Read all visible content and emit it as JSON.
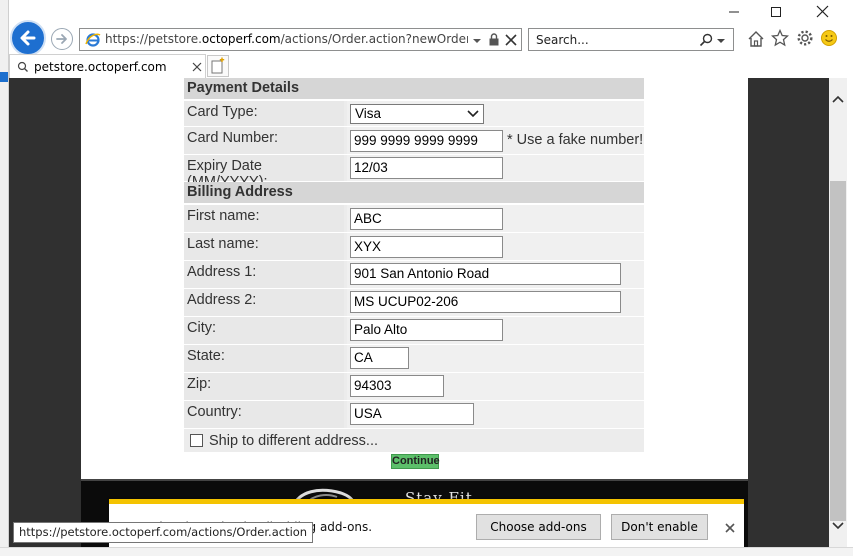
{
  "browser": {
    "address_url_prefix": "https://petstore.",
    "address_url_domain": "octoperf.com",
    "address_url_rest": "/actions/Order.action?newOrderForm=",
    "search_placeholder": "Search...",
    "tab_title": "petstore.octoperf.com",
    "status_url": "https://petstore.octoperf.com/actions/Order.action"
  },
  "form": {
    "payment_title": "Payment Details",
    "card_type_label": "Card Type:",
    "card_type_value": "Visa",
    "card_number_label": "Card Number:",
    "card_number_value": "999 9999 9999 9999",
    "card_number_hint": "* Use a fake number!",
    "expiry_label": "Expiry Date (MM/YYYY):",
    "expiry_value": "12/03",
    "billing_title": "Billing Address",
    "first_name_label": "First name:",
    "first_name_value": "ABC",
    "last_name_label": "Last name:",
    "last_name_value": "XYX",
    "address1_label": "Address 1:",
    "address1_value": "901 San Antonio Road",
    "address2_label": "Address 2:",
    "address2_value": "MS UCUP02-206",
    "city_label": "City:",
    "city_value": "Palo Alto",
    "state_label": "State:",
    "state_value": "CA",
    "zip_label": "Zip:",
    "zip_value": "94303",
    "country_label": "Country:",
    "country_value": "USA",
    "ship_label": "Ship to different address...",
    "continue_label": "Continue"
  },
  "banner": {
    "text": "Stay Fit"
  },
  "notification": {
    "message": "Speed up browsing by disabling add-ons.",
    "choose_label": "Choose add-ons",
    "dont_enable_label": "Don't enable"
  },
  "colors": {
    "ie_blue": "#1e6fd0",
    "notif_yellow": "#f4c300",
    "continue_green": "#5cbf6a"
  },
  "icons": [
    "back-arrow-icon",
    "forward-arrow-icon",
    "ie-logo-icon",
    "dropdown-chevron-icon",
    "lock-icon",
    "close-icon",
    "search-icon",
    "home-icon",
    "star-icon",
    "gear-icon",
    "smiley-icon",
    "search-tab-icon",
    "new-tab-icon",
    "scroll-up-icon",
    "scroll-down-icon"
  ]
}
